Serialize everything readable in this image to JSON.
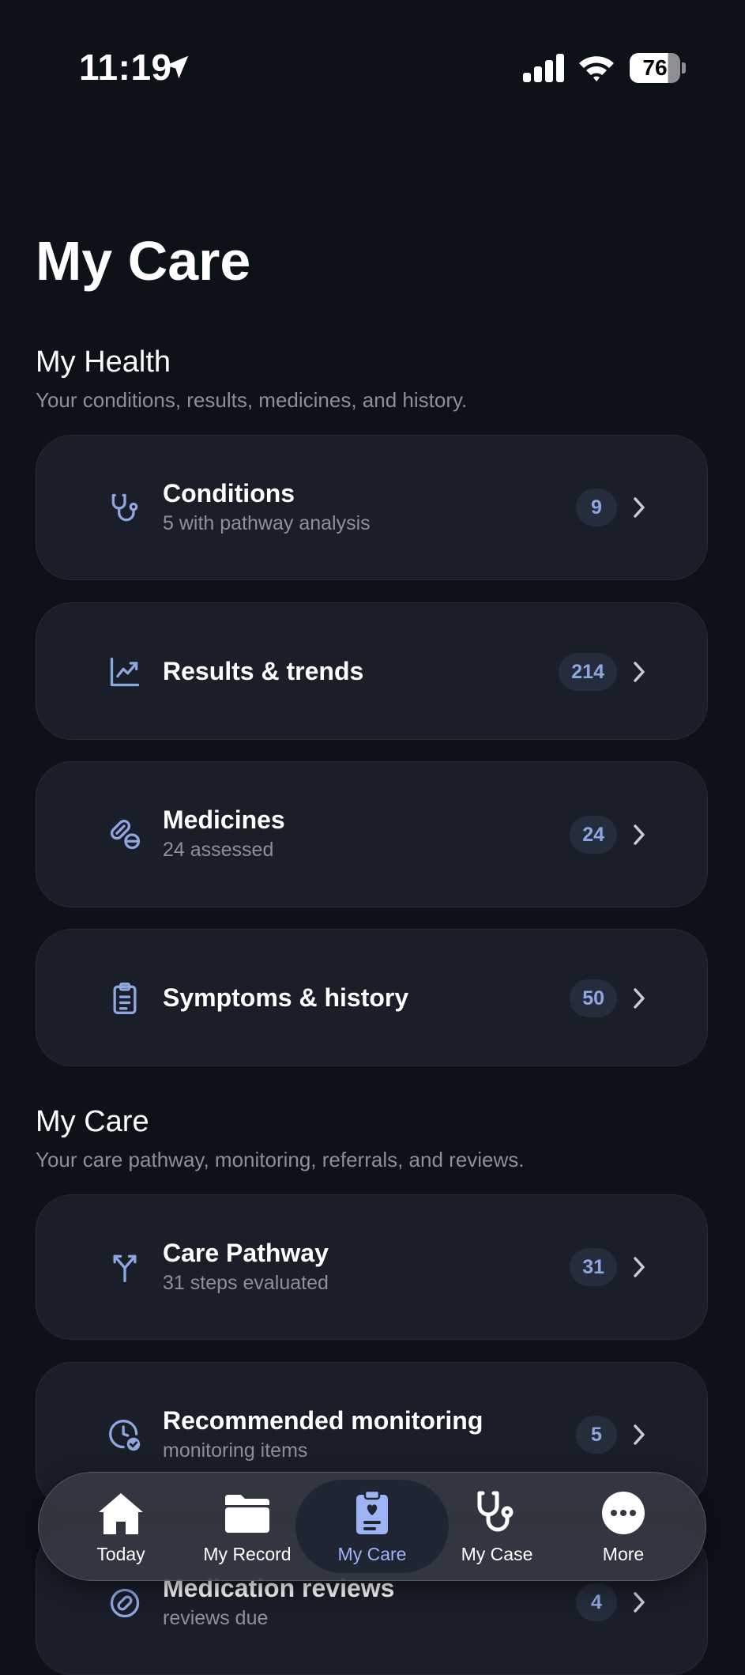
{
  "status_bar": {
    "time": "11:19",
    "battery": "76"
  },
  "page": {
    "title": "My Care"
  },
  "sections": [
    {
      "title": "My Health",
      "subtitle": "Your conditions, results, medicines, and history."
    },
    {
      "title": "My Care",
      "subtitle": "Your care pathway, monitoring, referrals, and reviews."
    }
  ],
  "cards": [
    {
      "title": "Conditions",
      "subtitle": "5 with pathway analysis",
      "count": "9",
      "icon": "stethoscope-icon"
    },
    {
      "title": "Results & trends",
      "subtitle": "",
      "count": "214",
      "icon": "chart-trend-icon"
    },
    {
      "title": "Medicines",
      "subtitle": "24 assessed",
      "count": "24",
      "icon": "pill-icon"
    },
    {
      "title": "Symptoms & history",
      "subtitle": "",
      "count": "50",
      "icon": "clipboard-list-icon"
    },
    {
      "title": "Care Pathway",
      "subtitle": "31 steps evaluated",
      "count": "31",
      "icon": "branch-icon"
    },
    {
      "title": "Recommended monitoring",
      "subtitle": "monitoring items",
      "count": "5",
      "icon": "clock-check-icon"
    },
    {
      "title": "Medication reviews",
      "subtitle": "reviews due",
      "count": "4",
      "icon": "pill-circle-icon"
    }
  ],
  "tab_bar": {
    "active": "My Care",
    "tabs": [
      {
        "label": "Today",
        "icon": "house-icon"
      },
      {
        "label": "My Record",
        "icon": "folder-icon"
      },
      {
        "label": "My Care",
        "icon": "clipboard-heart-icon"
      },
      {
        "label": "My Case",
        "icon": "stethoscope-icon"
      },
      {
        "label": "More",
        "icon": "ellipsis-circle-icon"
      }
    ]
  },
  "colors": {
    "background": "#0d1118",
    "card": "#1a1e29",
    "accent": "#8ea7e0",
    "active_tab": "#9db4f5"
  }
}
